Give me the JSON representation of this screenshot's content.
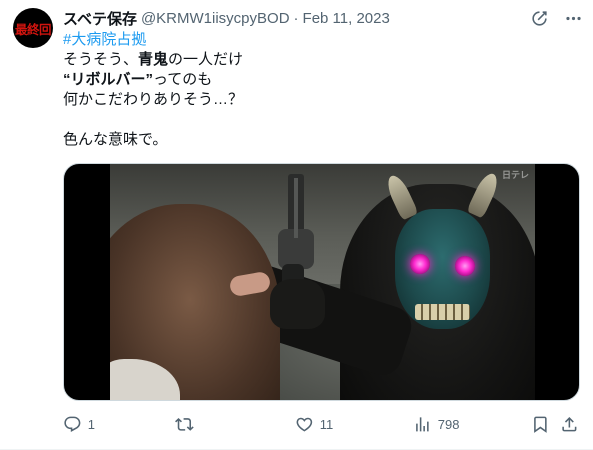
{
  "author": {
    "avatar_text": "最終回",
    "display_name": "スベテ保存",
    "handle": "@KRMW1iisycpyBOD",
    "separator": "·",
    "date": "Feb 11, 2023"
  },
  "tweet": {
    "hashtag": "#大病院占拠",
    "line2_pre": "そうそう、",
    "line2_bold": "青鬼",
    "line2_post": "の一人だけ",
    "line3_bold": "“リボルバー”",
    "line3_post": "ってのも",
    "line4": "何かこだわりありそう…？",
    "line6": "色んな意味で。"
  },
  "media": {
    "alt": "blue demon mask figure pointing revolver",
    "watermark": "日テレ"
  },
  "actions": {
    "reply_count": "1",
    "retweet_count": "",
    "like_count": "11",
    "views_count": "798"
  },
  "icons": {
    "grok": "grok-icon",
    "more": "more-icon",
    "reply": "reply-icon",
    "retweet": "retweet-icon",
    "like": "heart-icon",
    "views": "views-icon",
    "bookmark": "bookmark-icon",
    "share": "share-icon"
  },
  "colors": {
    "text": "#0f1419",
    "secondary": "#536471",
    "link": "#1d9bf0",
    "avatar_text": "#d1140f"
  }
}
